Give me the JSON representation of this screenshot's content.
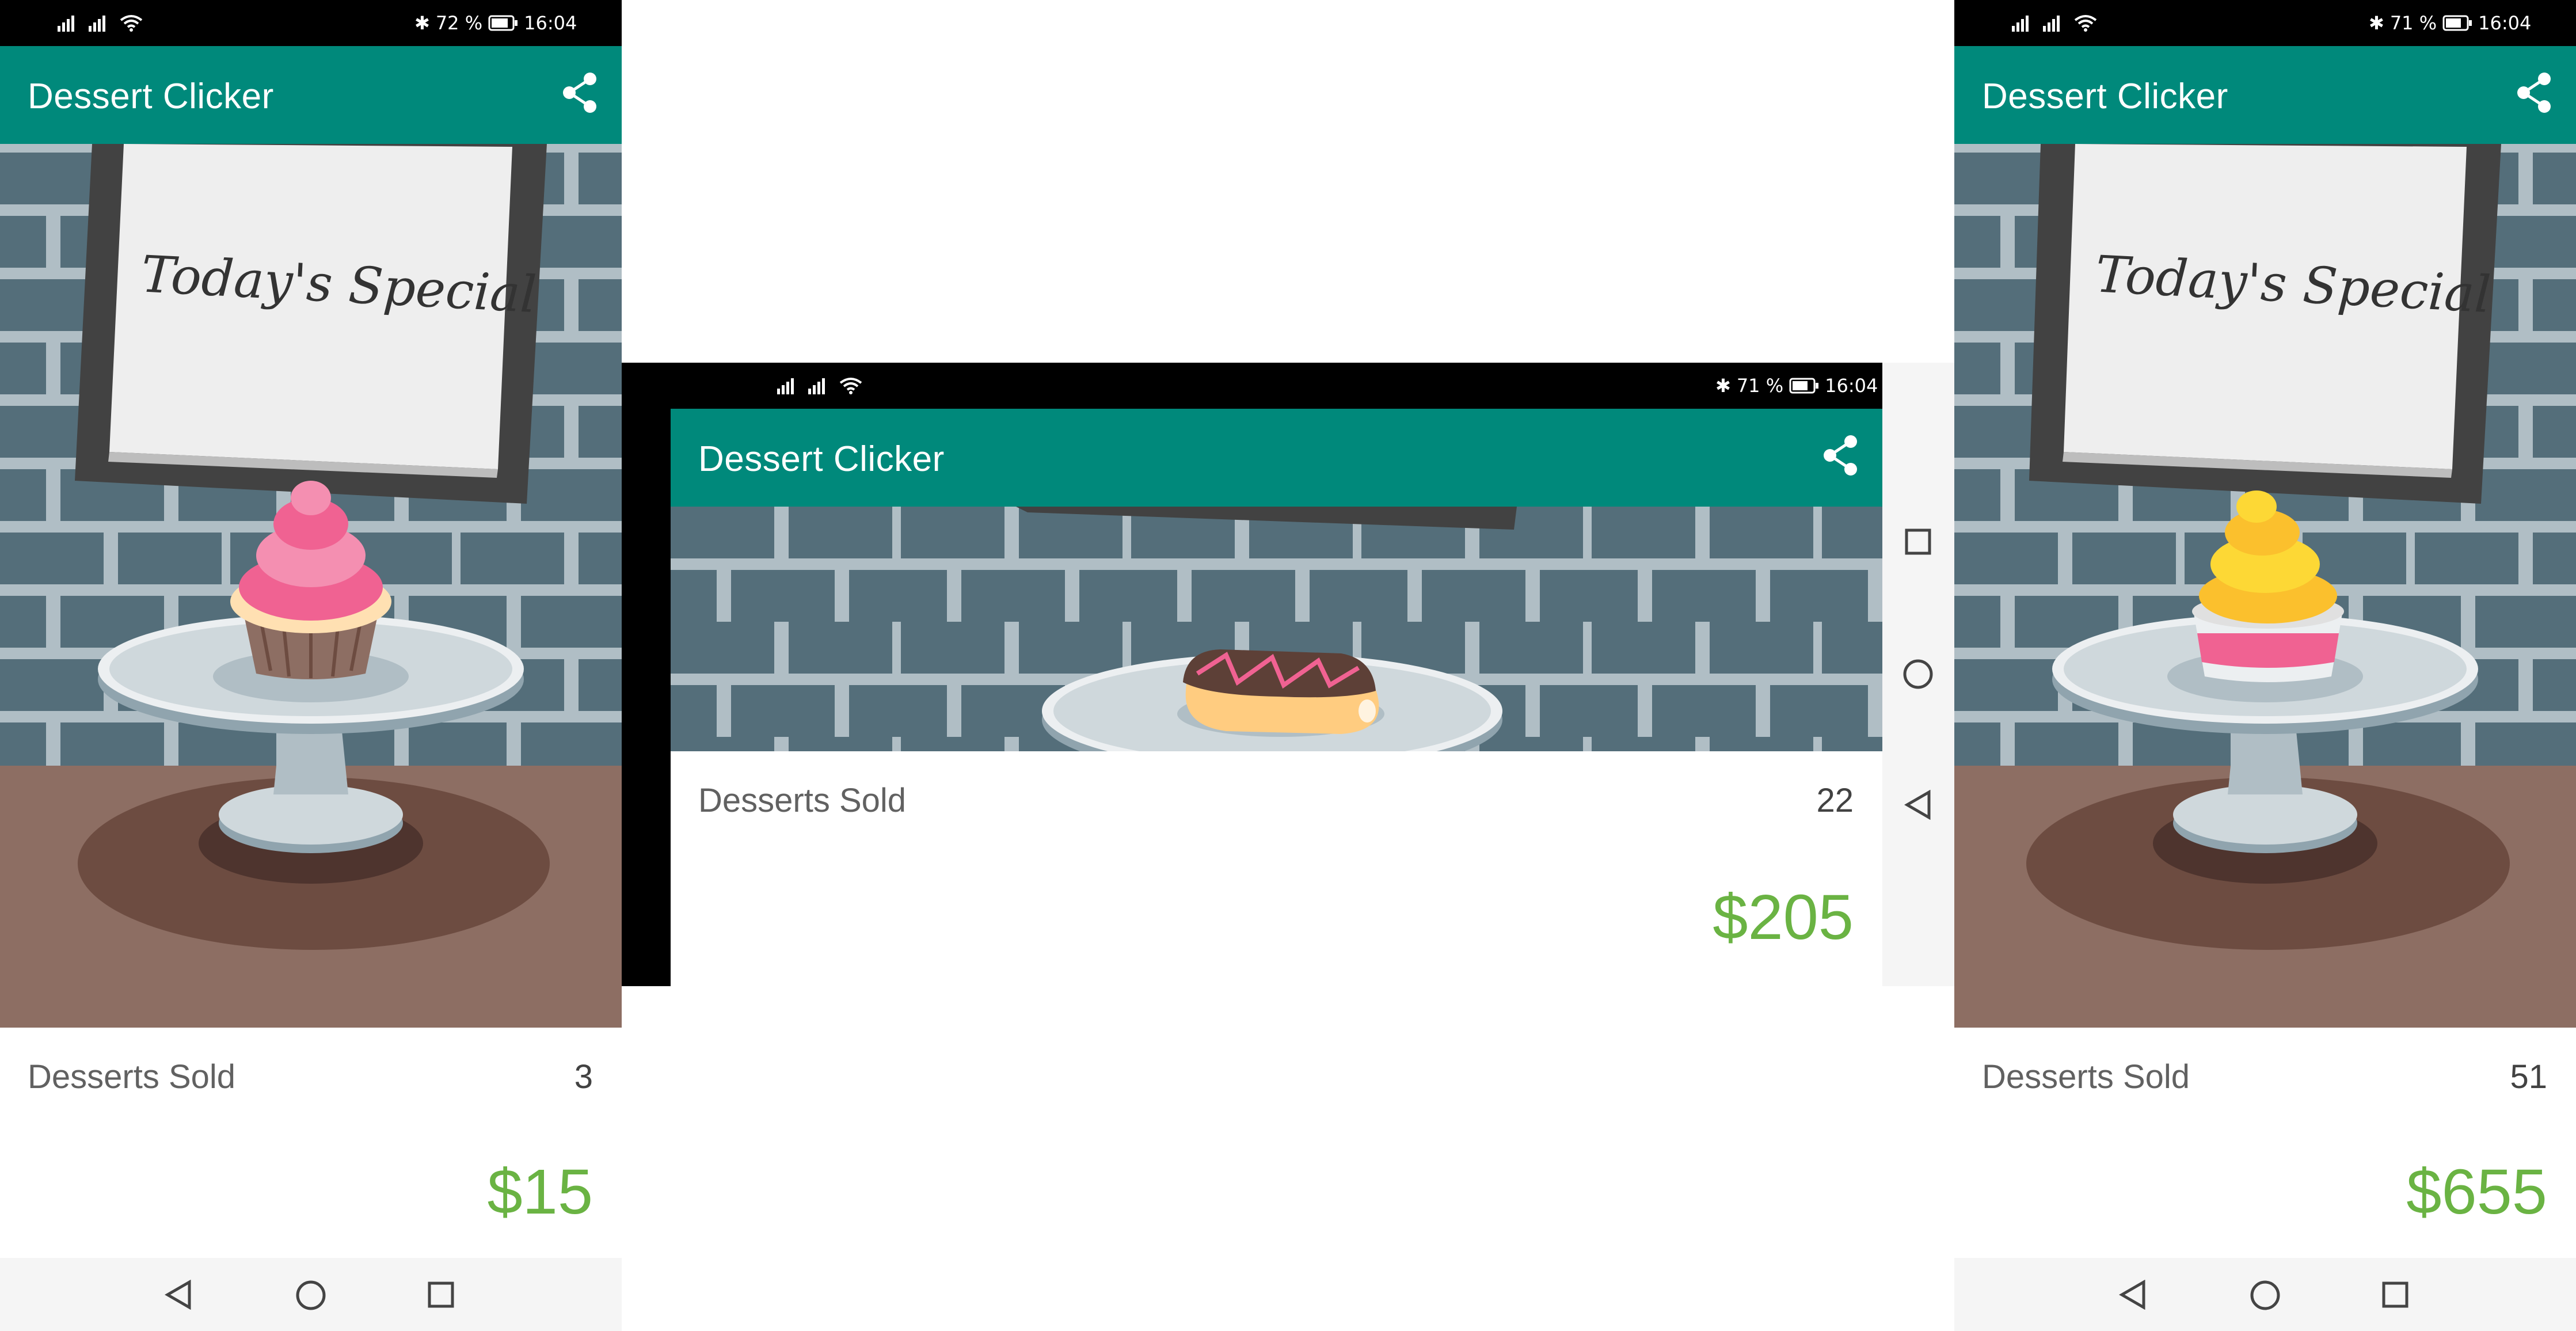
{
  "screens": [
    {
      "status": {
        "battery": "72 %",
        "time": "16:04"
      },
      "app_title": "Dessert Clicker",
      "sign_text": "Today's Special",
      "dessert_icon": "cupcake-icon",
      "stats": {
        "label": "Desserts Sold",
        "count": "3",
        "revenue": "$15"
      }
    },
    {
      "status": {
        "battery": "71 %",
        "time": "16:04"
      },
      "app_title": "Dessert Clicker",
      "dessert_icon": "eclair-icon",
      "stats": {
        "label": "Desserts Sold",
        "count": "22",
        "revenue": "$205"
      }
    },
    {
      "status": {
        "battery": "71 %",
        "time": "16:04"
      },
      "app_title": "Dessert Clicker",
      "sign_text": "Today's Special",
      "dessert_icon": "frozen-yogurt-icon",
      "stats": {
        "label": "Desserts Sold",
        "count": "51",
        "revenue": "$655"
      }
    }
  ],
  "icons": {
    "share": "share-icon",
    "signal": "cell-signal-icon",
    "wifi": "wifi-icon",
    "bluetooth": "bluetooth-icon",
    "battery": "battery-icon",
    "nav_back": "back-triangle-icon",
    "nav_home": "home-circle-icon",
    "nav_recents": "recents-square-icon"
  },
  "colors": {
    "app_bar": "#00897b",
    "revenue": "#6ab343",
    "brick_wall": "#546e7a",
    "mortar": "#b0bec5",
    "table": "#8d6e63"
  }
}
